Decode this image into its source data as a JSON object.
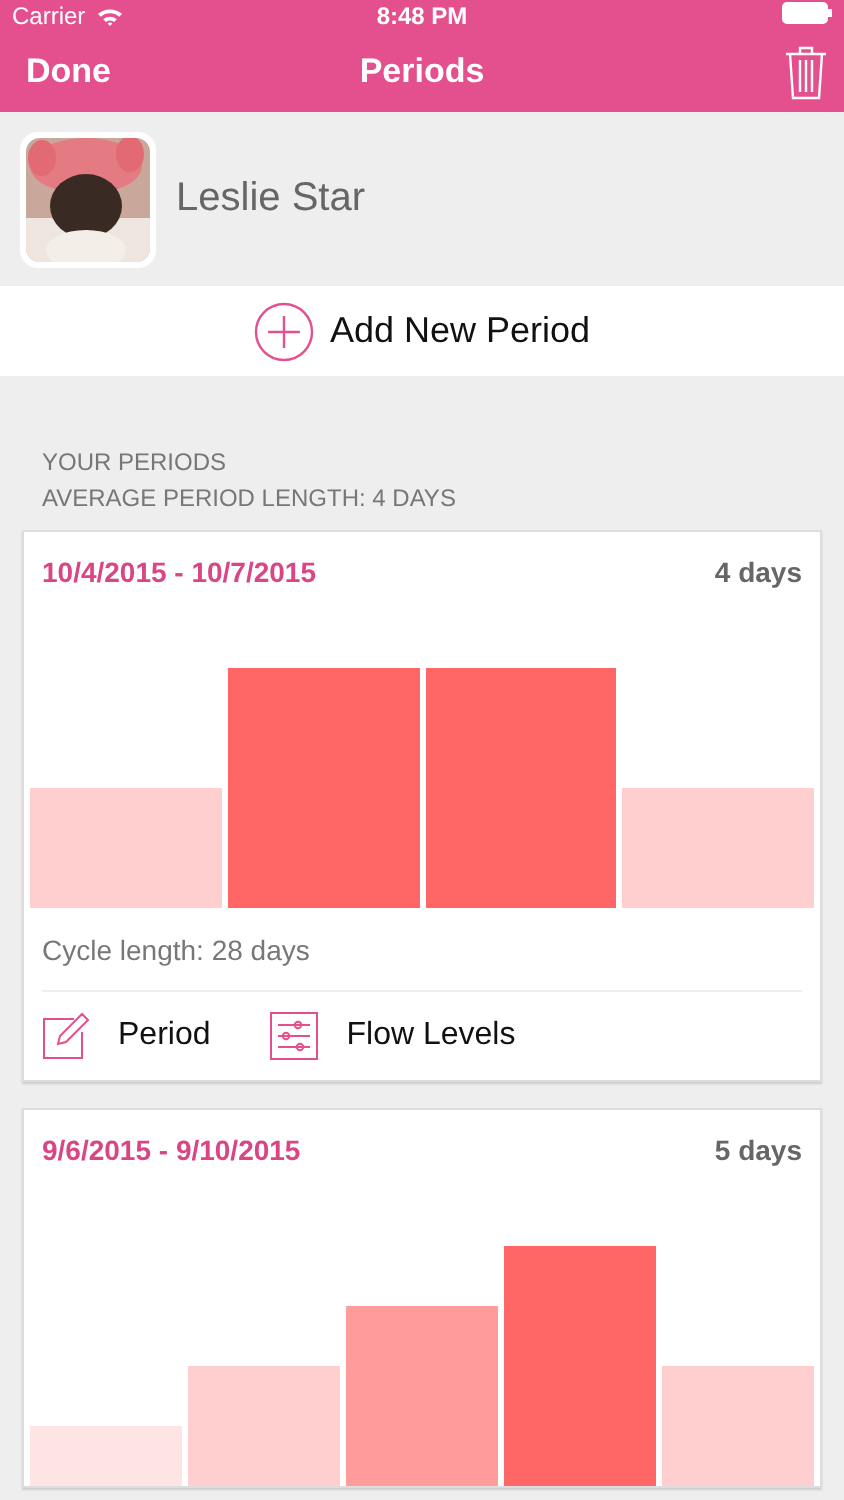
{
  "status_bar": {
    "carrier": "Carrier",
    "time": "8:48 PM"
  },
  "nav": {
    "left": "Done",
    "title": "Periods"
  },
  "profile": {
    "name": "Leslie Star"
  },
  "add_button": {
    "label": "Add New Period"
  },
  "section": {
    "title": "YOUR PERIODS",
    "subtitle": "AVERAGE PERIOD LENGTH: 4 DAYS"
  },
  "periods": [
    {
      "dates": "10/4/2015 - 10/7/2015",
      "length": "4 days",
      "days": [
        {
          "kind": "light"
        },
        {
          "kind": "heavy"
        },
        {
          "kind": "heavy"
        },
        {
          "kind": "light"
        }
      ],
      "cycle": "Cycle length: 28 days",
      "actions": [
        {
          "kind": "edit",
          "label": "Period"
        },
        {
          "kind": "sliders",
          "label": "Flow Levels"
        }
      ]
    },
    {
      "dates": "9/6/2015 - 9/10/2015",
      "length": "5 days",
      "days": [
        {
          "kind": "spotting"
        },
        {
          "kind": "light"
        },
        {
          "kind": "medium"
        },
        {
          "kind": "heavy"
        },
        {
          "kind": "light"
        }
      ]
    }
  ]
}
